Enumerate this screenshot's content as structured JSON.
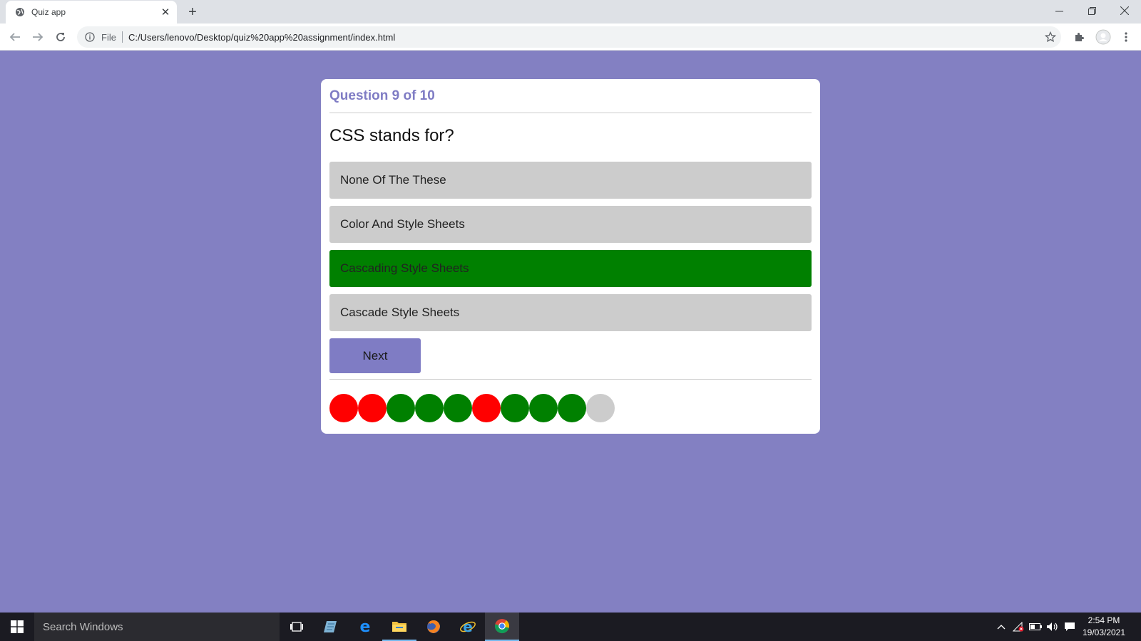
{
  "browser": {
    "tab_title": "Quiz app",
    "scheme_label": "File",
    "url": "C:/Users/lenovo/Desktop/quiz%20app%20assignment/index.html"
  },
  "quiz": {
    "progress_text": "Question 9 of 10",
    "question": "CSS stands for?",
    "options": [
      {
        "label": "None Of The These",
        "state": "default"
      },
      {
        "label": "Color And Style Sheets",
        "state": "default"
      },
      {
        "label": "Cascading Style Sheets",
        "state": "correct"
      },
      {
        "label": "Cascade Style Sheets",
        "state": "default"
      }
    ],
    "next_label": "Next",
    "results": [
      "wrong",
      "wrong",
      "correct",
      "correct",
      "correct",
      "wrong",
      "correct",
      "correct",
      "correct",
      "unanswered"
    ]
  },
  "colors": {
    "background": "#8380c2",
    "accent": "#7f7cc4",
    "correct": "#008000",
    "wrong": "#ff0000",
    "unanswered": "#cccccc",
    "option_default": "#cccccc"
  },
  "taskbar": {
    "search_placeholder": "Search Windows",
    "time": "2:54 PM",
    "date": "19/03/2021",
    "apps": [
      "task-view",
      "notepad",
      "edge",
      "file-explorer",
      "firefox",
      "internet-explorer",
      "chrome"
    ]
  }
}
